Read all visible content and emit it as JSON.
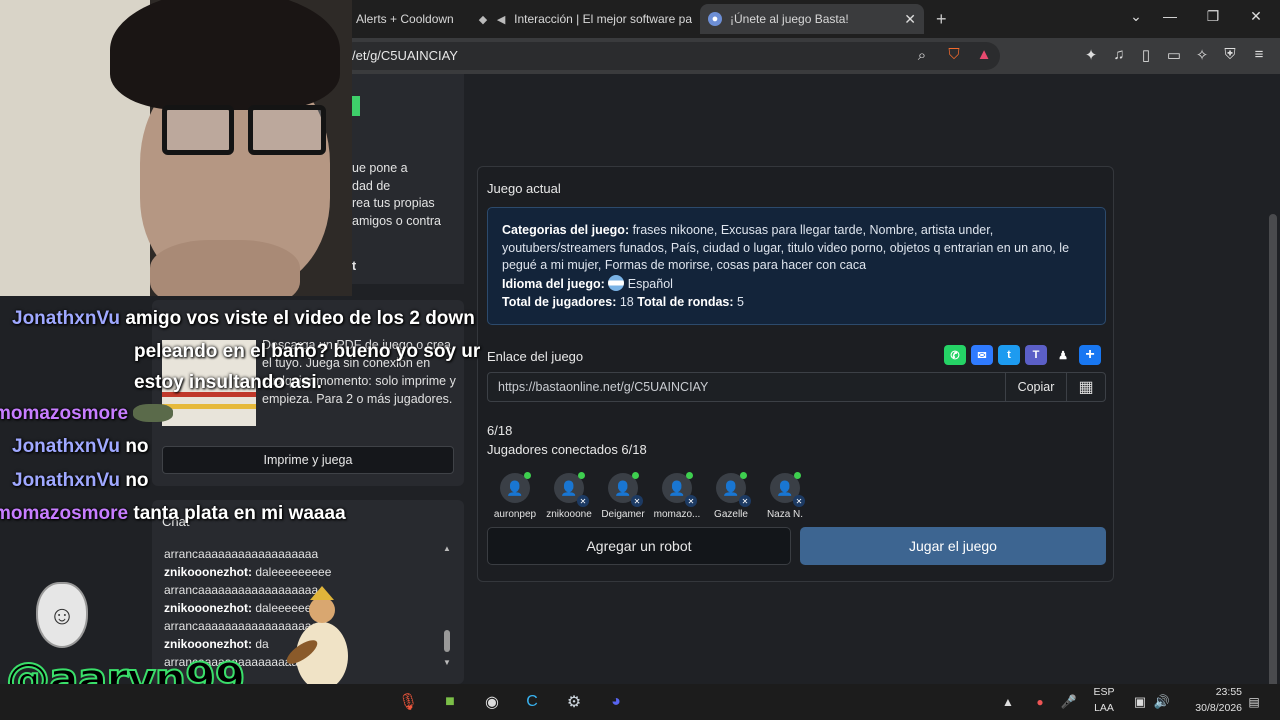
{
  "browser": {
    "tabs": [
      {
        "label": "Alerts + Cooldown",
        "icon": "puzzle-icon"
      },
      {
        "label": "Interacción | El mejor software pa",
        "icon": "diamond-icon"
      },
      {
        "label": "¡Únete al juego Basta!",
        "icon": "globe-icon",
        "active": true
      }
    ],
    "url": "/et/g/C5UAINCIAY"
  },
  "sidebar": {
    "fragment_lines": [
      "ue pone a",
      "dad de",
      "rea tus propias",
      "amigos o contra"
    ],
    "fragment_button": "t"
  },
  "print_card": {
    "text": "Descarga un PDF de juego o crea el tuyo. Juega sin conexión en cualquier momento: solo imprime y empieza. Para 2 o más jugadores.",
    "button": "Imprime y juega"
  },
  "chat": {
    "title": "Chat",
    "lines": [
      {
        "user": "",
        "text": "arrancaaaaaaaaaaaaaaaaaa"
      },
      {
        "user": "znikooonezhot:",
        "text": " daleeeeeeeee"
      },
      {
        "user": "",
        "text": "arrancaaaaaaaaaaaaaaaaaa"
      },
      {
        "user": "znikooonezhot:",
        "text": " daleeeeeeee"
      },
      {
        "user": "",
        "text": "arrancaaaaaaaaaaaaaaaaaa"
      },
      {
        "user": "znikooonezhot:",
        "text": " da"
      },
      {
        "user": "",
        "text": "arrancaaaaaaaaaaaaaaaaaa"
      }
    ]
  },
  "game": {
    "current_label": "Juego actual",
    "categories_label": "Categorias del juego:",
    "categories": " frases nikoone, Excusas para llegar tarde, Nombre, artista under, youtubers/streamers funados, País, ciudad o lugar, titulo video porno, objetos q entrarian en un ano, le pegué a mi mujer, Formas de morirse, cosas para hacer con caca",
    "language_label": "Idioma del juego:",
    "language": " Español",
    "players_label": "Total de jugadores:",
    "players": " 18",
    "rounds_label": "Total de rondas:",
    "rounds": " 5",
    "link_label": "Enlace del juego",
    "link": "https://bastaonline.net/g/C5UAINCIAY",
    "copy": "Copiar",
    "count": "6/18",
    "connected": "Jugadores conectados 6/18",
    "players_list": [
      "auronpep",
      "znikooone",
      "Deigamer",
      "momazo...",
      "Gazelle",
      "Naza N."
    ],
    "add_robot": "Agregar un robot",
    "play": "Jugar el juego"
  },
  "stream": {
    "messages": [
      {
        "user": "JonathxnVu",
        "text": "amigo vos viste el video de los 2 down"
      },
      {
        "user": "",
        "text": "peleando en el baño? bueno yo soy ur"
      },
      {
        "user": "",
        "text": "estoy insultando asi."
      },
      {
        "user": "momazosmore",
        "text": ""
      },
      {
        "user": "JonathxnVu",
        "text": "no"
      },
      {
        "user": "JonathxnVu",
        "text": "no"
      },
      {
        "user": "momazosmore",
        "text": "tanta plata en mi waaaa"
      }
    ],
    "handle": "@aarvn99",
    "colors": {
      "jonath": "#9fa8ff",
      "momazos": "#c77dff"
    }
  },
  "taskbar": {
    "lang": "ESP",
    "layout": "LAA",
    "time": "23:55",
    "date": "30/8/2026"
  }
}
